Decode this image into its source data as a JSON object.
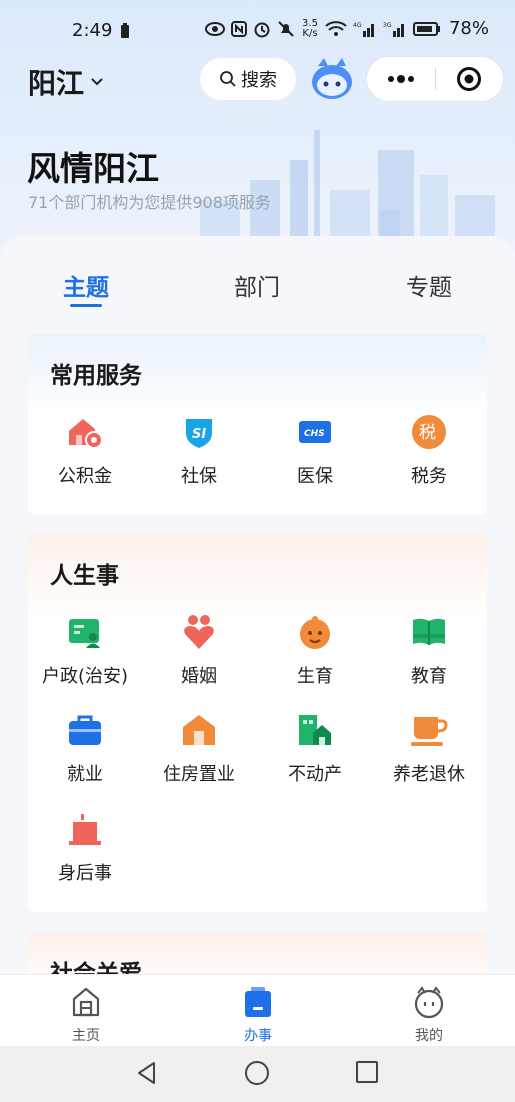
{
  "status_bar": {
    "time": "2:49",
    "net_speed": "3.5\nK/s",
    "battery_pct": "78%"
  },
  "header": {
    "city": "阳江",
    "search_label": "搜索",
    "title": "风情阳江",
    "subtitle": "71个部门机构为您提供908项服务"
  },
  "tabs": [
    {
      "label": "主题",
      "active": true
    },
    {
      "label": "部门",
      "active": false
    },
    {
      "label": "专题",
      "active": false
    }
  ],
  "common_services": {
    "title": "常用服务",
    "items": [
      {
        "label": "公积金",
        "icon": "housing-fund-icon",
        "color": "#f0655a"
      },
      {
        "label": "社保",
        "icon": "social-security-icon",
        "color": "#1aa4e8"
      },
      {
        "label": "医保",
        "icon": "medical-insurance-icon",
        "color": "#1f6fe6"
      },
      {
        "label": "税务",
        "icon": "tax-icon",
        "color": "#f08b3c"
      }
    ]
  },
  "life_events": {
    "title": "人生事",
    "items": [
      {
        "label": "户政(治安)",
        "icon": "household-icon",
        "color": "#20b36a"
      },
      {
        "label": "婚姻",
        "icon": "marriage-icon",
        "color": "#f0655a"
      },
      {
        "label": "生育",
        "icon": "birth-icon",
        "color": "#f08b3c"
      },
      {
        "label": "教育",
        "icon": "education-icon",
        "color": "#20b36a"
      },
      {
        "label": "就业",
        "icon": "employment-icon",
        "color": "#1f6fe6"
      },
      {
        "label": "住房置业",
        "icon": "housing-icon",
        "color": "#f08b3c"
      },
      {
        "label": "不动产",
        "icon": "real-estate-icon",
        "color": "#20b36a"
      },
      {
        "label": "养老退休",
        "icon": "retirement-icon",
        "color": "#f08b3c"
      },
      {
        "label": "身后事",
        "icon": "funeral-icon",
        "color": "#f0655a"
      }
    ]
  },
  "social_care": {
    "title": "社会关爱"
  },
  "bottom_nav": [
    {
      "label": "主页",
      "icon": "home-icon",
      "active": false
    },
    {
      "label": "办事",
      "icon": "services-icon",
      "active": true
    },
    {
      "label": "我的",
      "icon": "profile-icon",
      "active": false
    }
  ],
  "colors": {
    "accent": "#1f6fe6"
  }
}
